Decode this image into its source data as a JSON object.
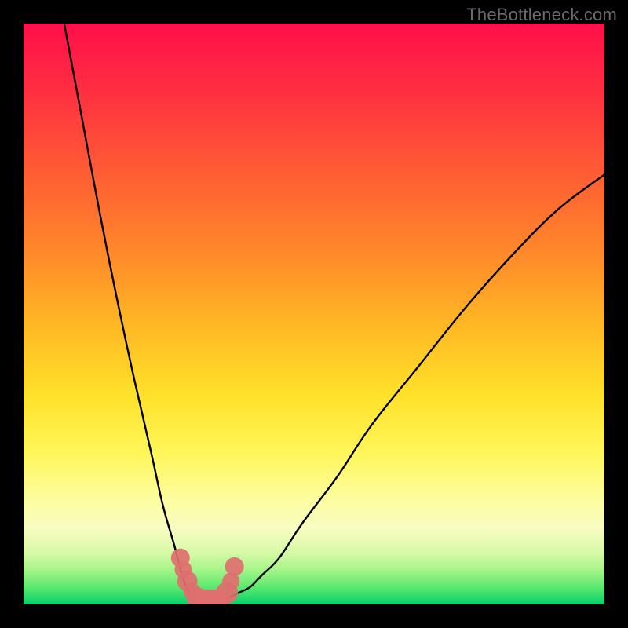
{
  "watermark": "TheBottleneck.com",
  "chart_data": {
    "type": "line",
    "title": "",
    "xlabel": "",
    "ylabel": "",
    "xlim": [
      0,
      100
    ],
    "ylim": [
      0,
      100
    ],
    "series": [
      {
        "name": "curve",
        "x": [
          7,
          10,
          13,
          16,
          19,
          22,
          24,
          26,
          27,
          28,
          29,
          30,
          31,
          32,
          33,
          35,
          37,
          39,
          41,
          44,
          48,
          54,
          60,
          68,
          76,
          84,
          92,
          100
        ],
        "values": [
          100,
          84,
          68,
          53,
          39,
          26,
          17,
          10,
          6,
          3,
          1,
          0,
          0,
          0,
          0,
          1,
          2,
          3,
          5,
          8,
          14,
          22,
          31,
          41,
          51,
          60,
          68,
          74
        ]
      }
    ],
    "markers": {
      "name": "highlight-dots",
      "color": "#df6f6f",
      "x": [
        27,
        27.5,
        28.2,
        29,
        30,
        31,
        32,
        33,
        34,
        35,
        35.7,
        36.3
      ],
      "values": [
        8,
        6,
        4,
        2.2,
        1,
        0.5,
        0.5,
        0.7,
        1,
        2,
        4,
        6.5
      ],
      "size": [
        12,
        11,
        13,
        11,
        14,
        15,
        15,
        14,
        12,
        14,
        11,
        12
      ]
    },
    "background_gradient": {
      "direction": "top-to-bottom",
      "stops": [
        {
          "pos": 0.0,
          "color": "#ff0f4a"
        },
        {
          "pos": 0.25,
          "color": "#ff5a35"
        },
        {
          "pos": 0.52,
          "color": "#ffb824"
        },
        {
          "pos": 0.74,
          "color": "#fff65a"
        },
        {
          "pos": 0.87,
          "color": "#f7fcc2"
        },
        {
          "pos": 1.0,
          "color": "#06d06a"
        }
      ]
    }
  }
}
